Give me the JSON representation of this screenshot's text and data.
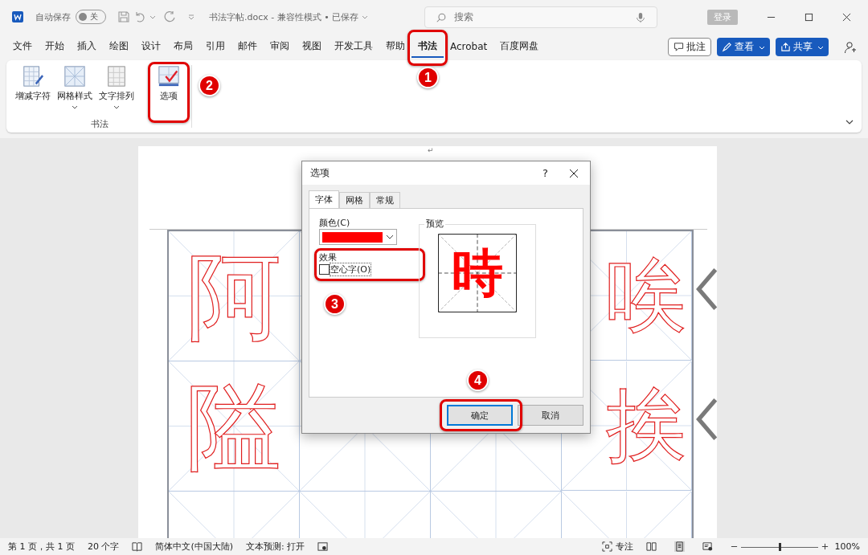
{
  "title_bar": {
    "autosave_label": "自动保存",
    "autosave_toggle": {
      "on": false,
      "label": "关"
    },
    "document_title": "书法字帖.docx  -  兼容性模式 • 已保存",
    "search": {
      "placeholder": "搜索"
    },
    "login_button": "登录"
  },
  "menu_tabs": [
    {
      "label": "文件",
      "selected": false
    },
    {
      "label": "开始",
      "selected": false
    },
    {
      "label": "插入",
      "selected": false
    },
    {
      "label": "绘图",
      "selected": false
    },
    {
      "label": "设计",
      "selected": false
    },
    {
      "label": "布局",
      "selected": false
    },
    {
      "label": "引用",
      "selected": false
    },
    {
      "label": "邮件",
      "selected": false
    },
    {
      "label": "审阅",
      "selected": false
    },
    {
      "label": "视图",
      "selected": false
    },
    {
      "label": "开发工具",
      "selected": false
    },
    {
      "label": "帮助",
      "selected": false
    },
    {
      "label": "书法",
      "selected": true
    },
    {
      "label": "Acrobat",
      "selected": false
    },
    {
      "label": "百度网盘",
      "selected": false
    }
  ],
  "menu_actions": {
    "comments": "批注",
    "view": "查看",
    "share": "共享"
  },
  "ribbon": {
    "buttons": [
      {
        "label": "增减字符",
        "kind": "pen",
        "dropdown": false
      },
      {
        "label": "网格样式",
        "kind": "grid",
        "dropdown": true
      },
      {
        "label": "文字排列",
        "kind": "text",
        "dropdown": true
      },
      {
        "label": "选项",
        "kind": "check",
        "dropdown": false
      }
    ],
    "group_label": "书法"
  },
  "document": {
    "paragraph_mark": "↵",
    "grid_rows": [
      {
        "first_column": "阿",
        "last_column": "唉"
      },
      {
        "first_column": "隘",
        "last_column": "挨"
      }
    ]
  },
  "dialog": {
    "title": "选项",
    "help": "?",
    "tabs": [
      {
        "label": "字体",
        "selected": true
      },
      {
        "label": "网格",
        "selected": false
      },
      {
        "label": "常规",
        "selected": false
      }
    ],
    "color_label": "颜色(C)",
    "effects_label": "效果",
    "hollow_checkbox": {
      "label": "空心字(O)",
      "checked": false
    },
    "preview_label": "预览",
    "preview_char": "時",
    "ok_button": "确定",
    "cancel_button": "取消"
  },
  "annotations": [
    {
      "number": "1"
    },
    {
      "number": "2"
    },
    {
      "number": "3"
    },
    {
      "number": "4"
    }
  ],
  "status_bar": {
    "page": "第 1 页，共 1 页",
    "words": "20 个字",
    "language": "简体中文(中国大陆)",
    "text_prediction": "文本预测: 打开",
    "focus": "专注",
    "zoom": {
      "level": 0.5
    },
    "zoom_percent": "100%"
  }
}
